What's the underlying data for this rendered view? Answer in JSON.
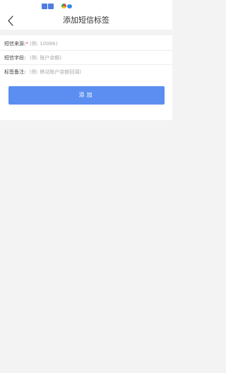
{
  "header": {
    "title": "添加短信标签",
    "back_icon": "chevron-left-icon"
  },
  "form": {
    "rows": [
      {
        "label": "短信来源:",
        "required_mark": "*",
        "placeholder": "(例: 10086)"
      },
      {
        "label": "短信字段:",
        "placeholder": "(例: 账户余额)"
      },
      {
        "label": "标签备注:",
        "placeholder": "(例: 移动账户余额回调)"
      }
    ]
  },
  "actions": {
    "add_label": "添加"
  },
  "colors": {
    "accent": "#5b8ef0",
    "page_bg": "#f3f3f3",
    "required": "#e33b3b"
  }
}
